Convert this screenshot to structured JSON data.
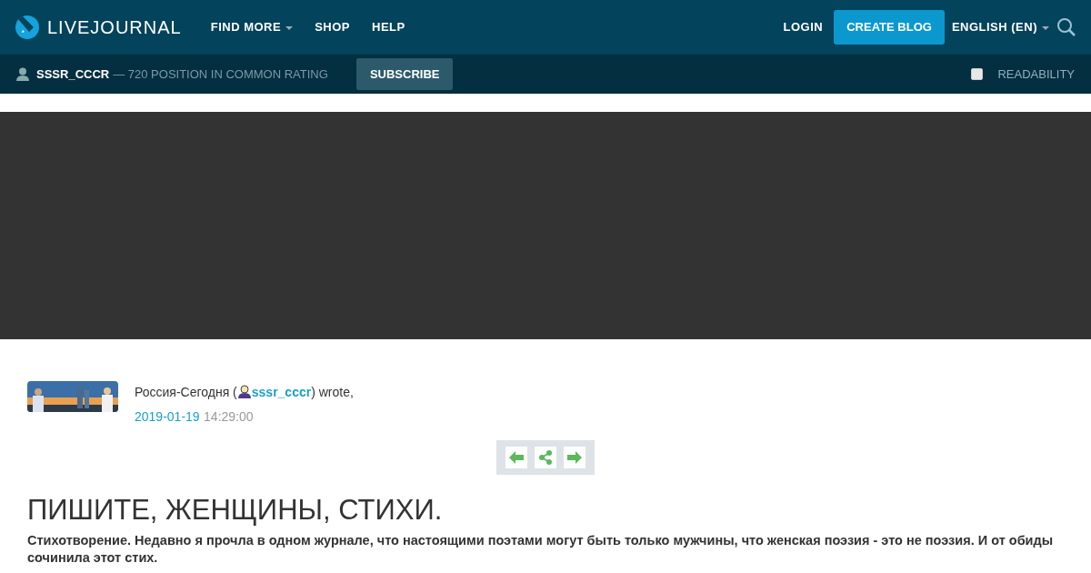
{
  "navbar": {
    "logo": "LIVEJOURNAL",
    "menu": [
      {
        "label": "FIND MORE",
        "dropdown": true
      },
      {
        "label": "SHOP",
        "dropdown": false
      },
      {
        "label": "HELP",
        "dropdown": false
      }
    ],
    "login": "LOGIN",
    "create_button": "CREATE BLOG",
    "language": "ENGLISH (EN)"
  },
  "journal_bar": {
    "user": "SSSR_CCCR",
    "rating": "— 720 POSITION IN COMMON RATING",
    "subscribe": "SUBSCRIBE",
    "readability": {
      "label": "READABILITY",
      "checked": false
    }
  },
  "post": {
    "author": "Россия-Сегодня (",
    "username": "sssr_cccr",
    "wrote": ") wrote,",
    "date": "2019-01-19",
    "time": "14:29:00",
    "title": "ПИШИТЕ, ЖЕНЩИНЫ, СТИХИ.",
    "body": "Стихотворение. Недавно я прочла в одном журнале, что настоящими поэтами могут быть только мужчины, что женская поэзия - это не поэзия. И от обиды сочинила этот стих."
  }
}
